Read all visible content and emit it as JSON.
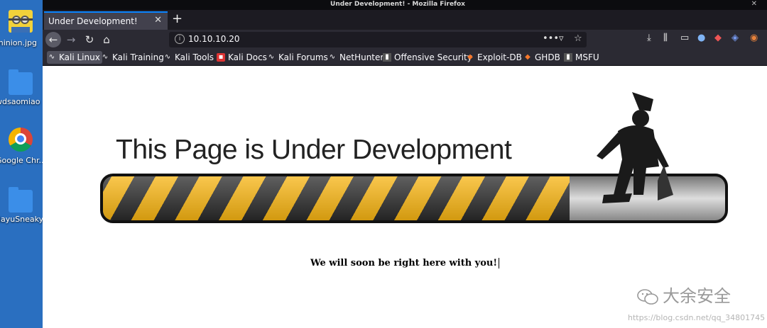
{
  "window": {
    "title": "Under Development! - Mozilla Firefox"
  },
  "desktop": {
    "icons": [
      {
        "label": "minion.jpg"
      },
      {
        "label": "wdsaomiao"
      },
      {
        "label": "Google Chr..."
      },
      {
        "label": "dayuSneaky"
      }
    ]
  },
  "tab": {
    "label": "Under Development!"
  },
  "address": {
    "url": "10.10.10.20"
  },
  "bookmarks": [
    {
      "label": "Kali Linux"
    },
    {
      "label": "Kali Training"
    },
    {
      "label": "Kali Tools"
    },
    {
      "label": "Kali Docs"
    },
    {
      "label": "Kali Forums"
    },
    {
      "label": "NetHunter"
    },
    {
      "label": "Offensive Security"
    },
    {
      "label": "Exploit-DB"
    },
    {
      "label": "GHDB"
    },
    {
      "label": "MSFU"
    }
  ],
  "page": {
    "heading": "This Page is Under Development",
    "message": "We will soon be right here with you!",
    "progress": 0.75,
    "stripe_colors": [
      "#f7b412",
      "#2a2a2a"
    ]
  },
  "watermark": {
    "text": "大余安全",
    "url": "https://blog.csdn.net/qq_34801745"
  }
}
